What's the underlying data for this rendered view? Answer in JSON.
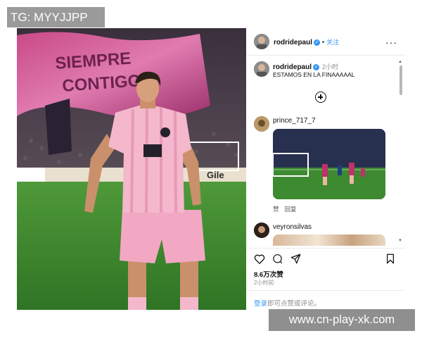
{
  "watermark_top": "TG: MYYJJPP",
  "watermark_bottom": "www.cn-play-xk.com",
  "photo": {
    "banner_text_1": "SIEMPRE",
    "banner_text_2": "CONTIGO",
    "ad_board": "Gile"
  },
  "post": {
    "username": "rodridepaul",
    "verified_glyph": "✓",
    "separator": "•",
    "follow_label": "关注",
    "more_label": "···",
    "caption_user": "rodridepaul",
    "caption_time": "2小时",
    "caption_text": "ESTAMOS EN LA FINAAAAAL 󠀠󠀠󠀠",
    "likes": "8.6万次赞",
    "time": "2小时前",
    "login_link": "登录",
    "login_rest": "即可点赞或评论。"
  },
  "comments": [
    {
      "username": "prince_717_7",
      "like_label": "赞",
      "reply_label": "回复"
    },
    {
      "username": "veyronsilvas"
    }
  ],
  "icons": {
    "heart": "heart-icon",
    "comment": "comment-icon",
    "share": "share-icon",
    "bookmark": "bookmark-icon"
  },
  "colors": {
    "link_blue": "#3897f0",
    "jersey_pink": "#f4b7cc",
    "pitch_green": "#3f8a2e"
  }
}
